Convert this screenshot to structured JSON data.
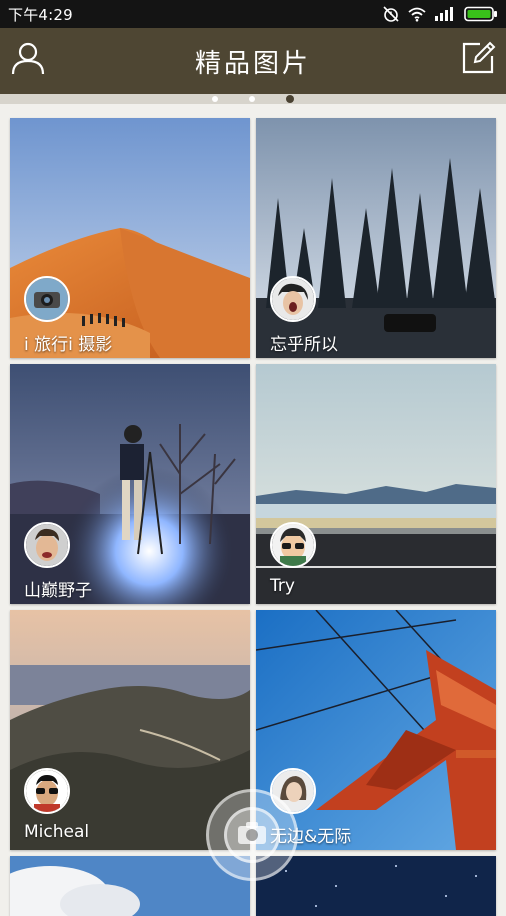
{
  "status_bar": {
    "time": "下午4:29",
    "icons": [
      "alarm-off-icon",
      "wifi-icon",
      "signal-icon",
      "battery-icon"
    ]
  },
  "header": {
    "title": "精品图片",
    "left_icon": "user-icon",
    "right_icon": "edit-icon"
  },
  "page_indicator": {
    "count": 3,
    "active_index": 2
  },
  "gallery": {
    "cards": [
      {
        "name": "i 旅行i 摄影"
      },
      {
        "name": "忘乎所以"
      },
      {
        "name": "山巅野子"
      },
      {
        "name": "Try"
      },
      {
        "name": "Micheal"
      },
      {
        "name": "无边&无际"
      },
      {
        "name": ""
      },
      {
        "name": ""
      }
    ]
  },
  "fab": {
    "icon": "camera-icon"
  },
  "colors": {
    "header_bg": "#4e4633",
    "status_bg": "#141414",
    "page_bg": "#f1f0ec",
    "battery_green": "#39c01a"
  }
}
